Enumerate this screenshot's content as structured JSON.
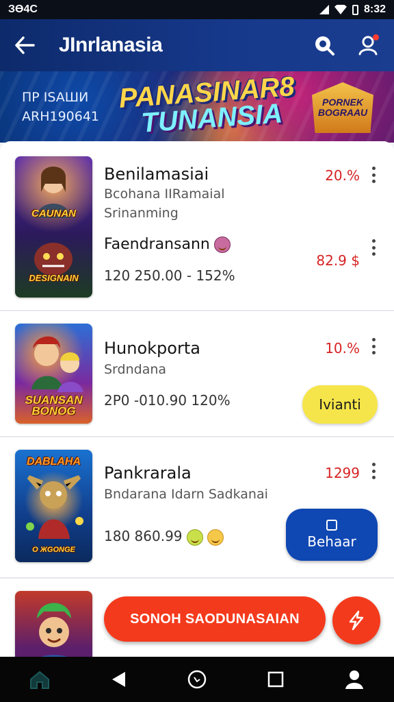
{
  "status_bar": {
    "left_text": "ЗӨ4С",
    "time": "8:32"
  },
  "app_bar": {
    "title": "JInrlanasia",
    "back_icon": "arrow-left-icon",
    "search_icon": "search-icon",
    "profile_icon": "user-icon",
    "has_notification": true
  },
  "banner": {
    "left_line1": "ПР ISAШИ",
    "left_line2": "ARH190641",
    "headline_line1": "PANASINAR8",
    "headline_line2": "TUNANSIA",
    "badge_line1": "PORNEK",
    "badge_line2": "BOGRAAU"
  },
  "items": [
    {
      "thumb_caption_top": "CAUNAN",
      "thumb_caption_bottom": "DESIGNAIN",
      "name": "Benilamasiai",
      "subtitle1": "Bcohana IIRamaial",
      "subtitle2": "Srinanming",
      "price": "20.%",
      "name2": "Faendransann",
      "price2": "82.9 $",
      "stats": "120 250.00 - 152%"
    },
    {
      "thumb_caption_top": "",
      "thumb_caption_bottom": "SUANSAN BONOG",
      "name": "Hunokporta",
      "subtitle1": "Srdndana",
      "price": "10.%",
      "stats": "2P0 -010.90   120%",
      "button": "Ivianti"
    },
    {
      "thumb_caption_top": "DABLAHA",
      "thumb_caption_bottom": "O ЖGONGE",
      "name": "Pankrarala",
      "subtitle1": "Bndarana  Idarn Sadkanai",
      "price": "1299",
      "stats": "180 860.99",
      "button": "Behaar"
    }
  ],
  "cta_label": "SONOH SAODUNASAIAN",
  "fab_icon": "lightning-icon",
  "nav": {
    "home_icon": "home-icon",
    "back_icon": "triangle-back-icon",
    "assistant_icon": "circle-home-icon",
    "recents_icon": "square-recents-icon",
    "account_icon": "user-icon"
  },
  "colors": {
    "app_bar": "#17398c",
    "price": "#d62222",
    "cta": "#f43a1c",
    "yellow_button": "#f5e54a",
    "blue_button": "#0f47b3"
  }
}
